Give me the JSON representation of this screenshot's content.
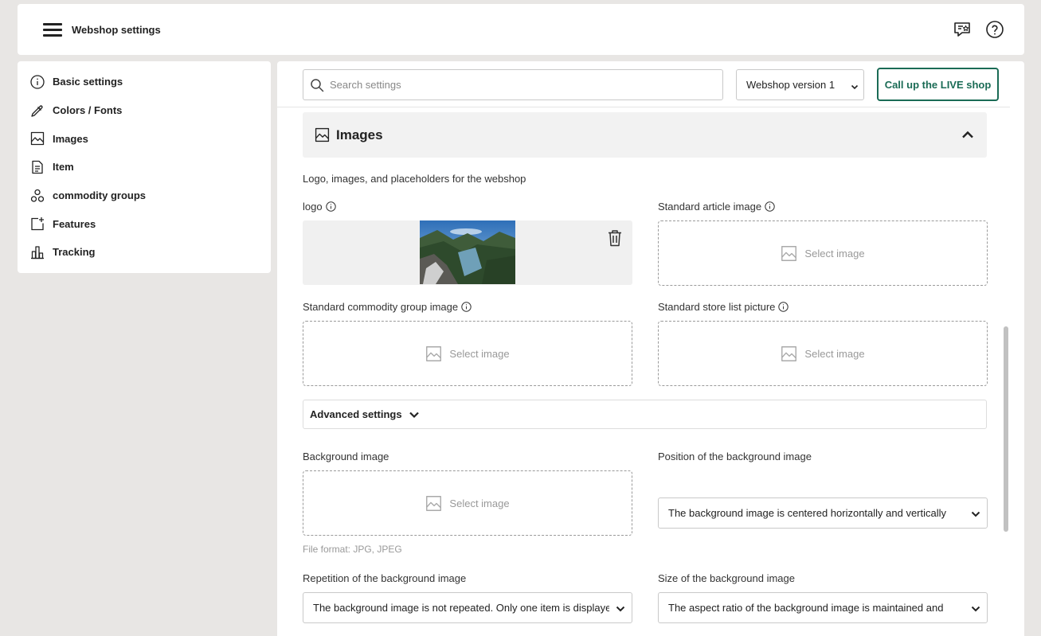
{
  "header": {
    "title": "Webshop settings",
    "menu_icon": "hamburger-menu-icon",
    "feedback_icon": "feedback-star-icon",
    "help_icon": "help-icon"
  },
  "sidebar": {
    "items": [
      {
        "label": "Basic settings",
        "icon": "info-icon"
      },
      {
        "label": "Colors / Fonts",
        "icon": "color-picker-icon"
      },
      {
        "label": "Images",
        "icon": "image-icon"
      },
      {
        "label": "Item",
        "icon": "document-icon"
      },
      {
        "label": "commodity groups",
        "icon": "groups-icon"
      },
      {
        "label": "Features",
        "icon": "add-feature-icon"
      },
      {
        "label": "Tracking",
        "icon": "bar-chart-icon"
      }
    ]
  },
  "toolbar": {
    "search_placeholder": "Search settings",
    "version_selected": "Webshop version 1",
    "live_button": "Call up the LIVE shop"
  },
  "section": {
    "title": "Images",
    "description": "Logo, images, and placeholders for the webshop"
  },
  "fields": {
    "logo_label": "logo",
    "standard_article_label": "Standard article image",
    "standard_group_label": "Standard commodity group image",
    "standard_store_label": "Standard store list picture",
    "select_image": "Select image",
    "advanced_settings": "Advanced settings",
    "background_image_label": "Background image",
    "background_format_hint": "File format: JPG, JPEG",
    "position_label": "Position of the background image",
    "position_value": "The background image is centered horizontally and vertically",
    "repetition_label": "Repetition of the background image",
    "repetition_value": "The background image is not repeated. Only one item is displayed",
    "size_label": "Size of the background image",
    "size_value": "The aspect ratio of the background image is maintained and"
  },
  "colors": {
    "accent": "#1a6b55",
    "background": "#e8e6e4"
  }
}
